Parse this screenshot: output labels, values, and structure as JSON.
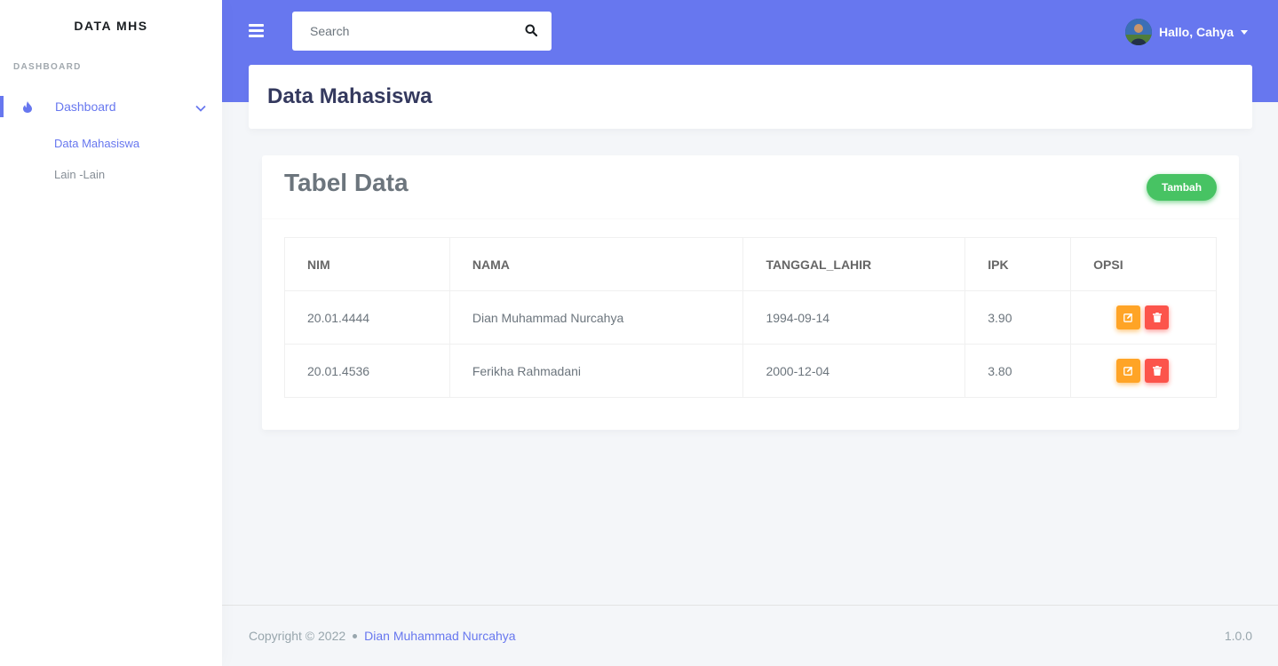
{
  "sidebar": {
    "brand": "DATA MHS",
    "menu_header": "DASHBOARD",
    "dashboard_label": "Dashboard",
    "items": [
      {
        "label": "Data Mahasiswa"
      },
      {
        "label": "Lain -Lain"
      }
    ]
  },
  "navbar": {
    "search_placeholder": "Search",
    "user_greeting": "Hallo, Cahya"
  },
  "page": {
    "title": "Data Mahasiswa"
  },
  "card": {
    "title": "Tabel Data",
    "add_label": "Tambah"
  },
  "table": {
    "headers": [
      "NIM",
      "NAMA",
      "TANGGAL_LAHIR",
      "IPK",
      "OPSI"
    ],
    "rows": [
      {
        "nim": "20.01.4444",
        "nama": "Dian Muhammad Nurcahya",
        "tanggal_lahir": "1994-09-14",
        "ipk": "3.90"
      },
      {
        "nim": "20.01.4536",
        "nama": "Ferikha Rahmadani",
        "tanggal_lahir": "2000-12-04",
        "ipk": "3.80"
      }
    ]
  },
  "footer": {
    "copyright": "Copyright © 2022",
    "author": "Dian Muhammad Nurcahya",
    "version": "1.0.0"
  },
  "colors": {
    "primary": "#6777ef",
    "success": "#47c363",
    "warning": "#ffa426",
    "danger": "#fc544b"
  },
  "icons": {
    "menu": "hamburger-icon",
    "search": "search-icon",
    "dashboard": "fire-icon",
    "chevron": "chevron-down-icon",
    "edit": "edit-icon",
    "delete": "trash-icon"
  }
}
